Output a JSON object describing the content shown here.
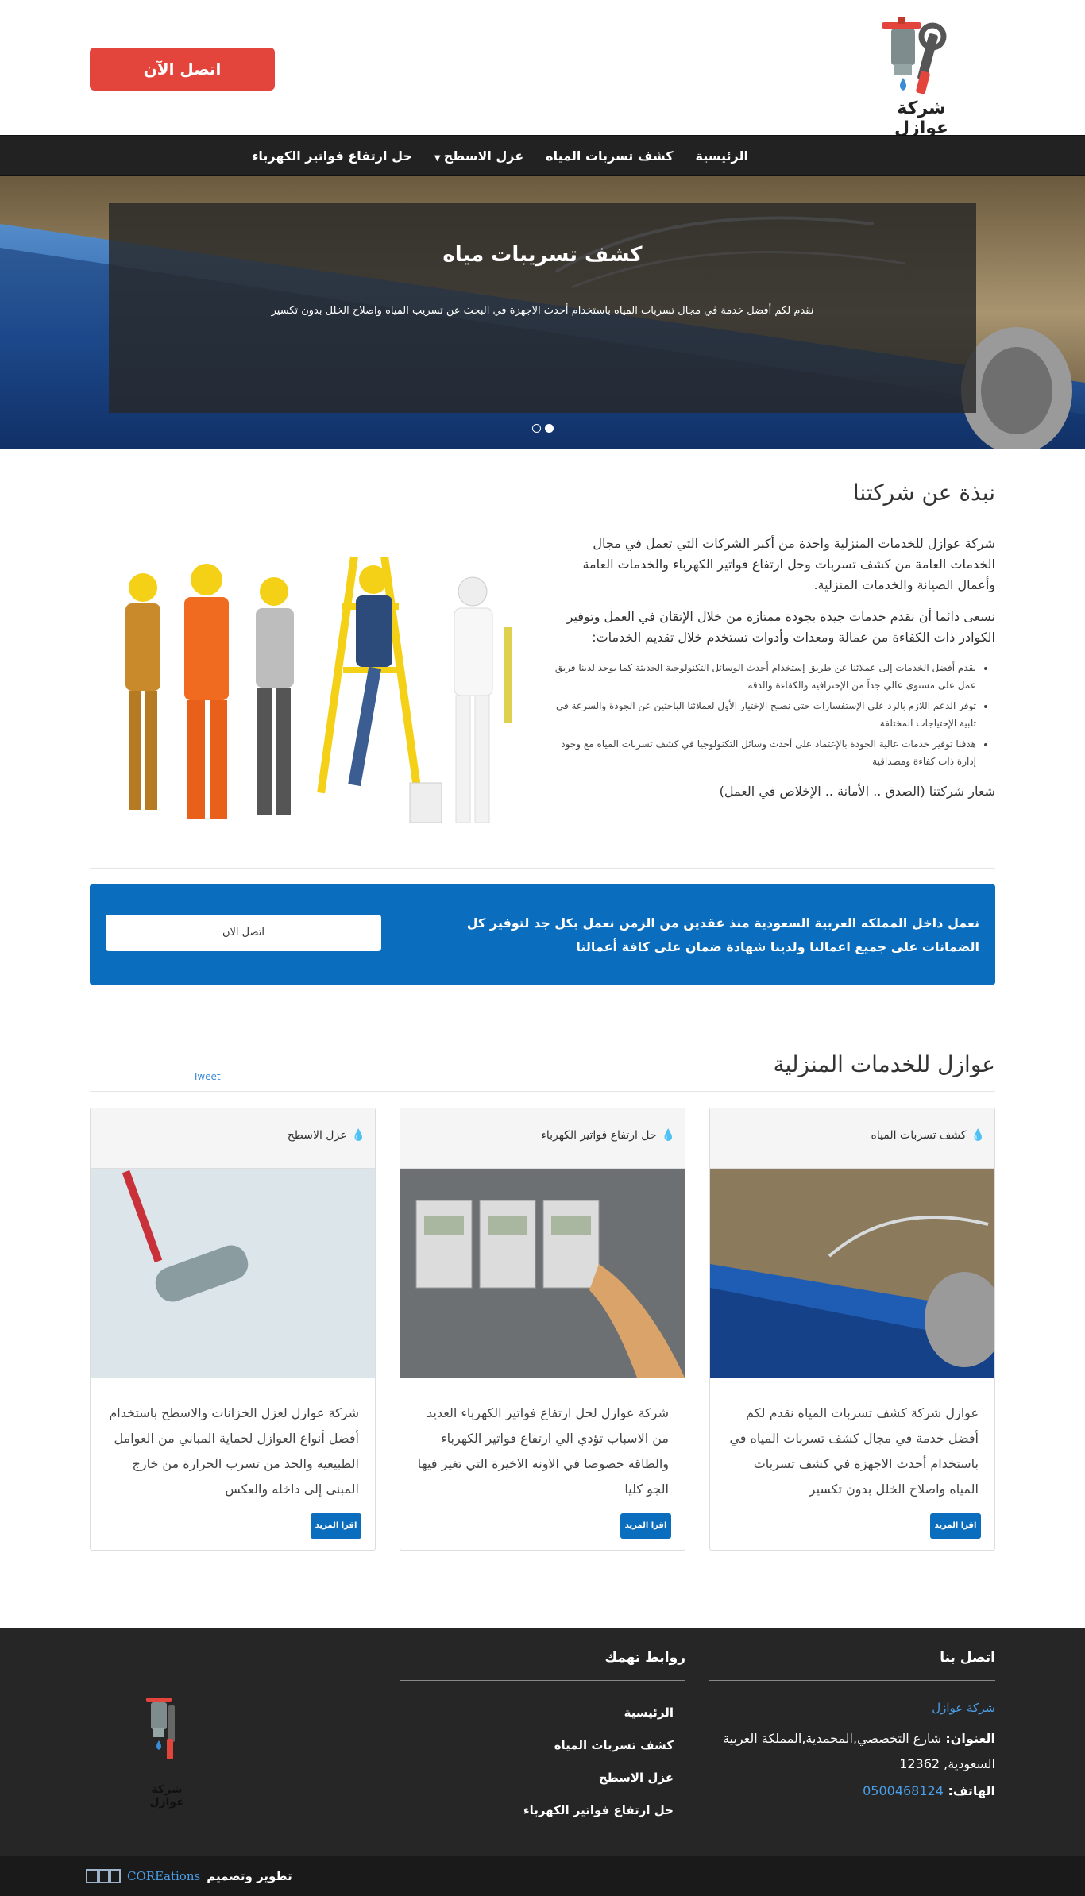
{
  "header": {
    "logo_text": "شركة عوازل",
    "call_button": "اتصل الآن 0500468124"
  },
  "nav": {
    "items": [
      {
        "label": "الرئيسية"
      },
      {
        "label": "كشف تسربات المياه"
      },
      {
        "label": "عزل الاسطح"
      },
      {
        "label": "حل ارتفاع فواتير الكهرباء"
      }
    ]
  },
  "hero": {
    "title": "كشف تسريبات مياه",
    "subtitle": "نقدم لكم أفضل خدمة في مجال تسربات المياه باستخدام أحدث الاجهزة في البحث عن تسريب المياه واصلاح الخلل بدون تكسير",
    "slide_count": 2,
    "active_slide": 2
  },
  "about": {
    "title": "نبذة عن شركتنا",
    "p1": "شركة عوازل للخدمات المنزلية واحدة من أكبر الشركات التي تعمل في مجال الخدمات العامة من كشف تسربات وحل ارتفاع فواتير الكهرباء والخدمات العامة وأعمال الصيانة والخدمات المنزلية.",
    "p2": "نسعى دائما أن نقدم خدمات جيدة بجودة ممتازة من خلال الإتقان في العمل وتوفير الكوادر ذات الكفاءة من عمالة ومعدات وأدوات تستخدم خلال تقديم الخدمات:",
    "bullets": [
      "نقدم أفضل الخدمات إلى عملائنا عن طريق إستخدام أحدث الوسائل التكنولوجية الحديثة كما يوجد لدينا فريق عمل على مستوى عالي جداً من الإحترافية والكفاءة والدقة",
      "توفر الدعم اللازم بالرد على الإستفسارات حتى نصبح الإختيار الأول لعملائنا الباحثين عن الجودة والسرعة في تلبية الإحتياجات المختلفة",
      "هدفنا توفير خدمات عالية الجودة بالإعتماد على أحدث وسائل التكنولوجيا في كشف تسربات المياه مع وجود إدارة ذات كفاءة ومصداقية"
    ],
    "slogan": "شعار شركتنا (الصدق .. الأمانة .. الإخلاص في العمل)"
  },
  "banner": {
    "text": "نعمل داخل المملكه العربية السعودية منذ عقدين من الزمن نعمل بكل جد لتوفير كل الضمانات على جميع اعمالنا ولدينا شهادة ضمان على كافة أعمالنا",
    "button": "اتصل الان"
  },
  "services": {
    "title": "عوازل للخدمات المنزلية",
    "tweet": "Tweet",
    "cards": [
      {
        "title": "كشف تسربات المياه",
        "text": "عوازل شركة كشف تسربات المياه نقدم لكم أفضل خدمة في مجال كشف تسربات المياه في باستخدام أحدث الاجهزة في كشف تسربات المياه واصلاح الخلل بدون تكسير",
        "button": "اقرا المزيد"
      },
      {
        "title": "حل ارتفاع فواتير الكهرباء",
        "text": "شركة عوازل لحل ارتفاع فواتير الكهرباء العديد من الاسباب تؤدي الي ارتفاع فواتير الكهرباء والطاقة خصوصا في الاونه الاخيرة التي تغير فيها الجو كليا",
        "button": "اقرا المزيد"
      },
      {
        "title": "عزل الاسطح",
        "text": "شركة عوازل لعزل الخزانات والاسطح باستخدام أفضل أنواع العوازل لحماية المباني من العوامل الطبيعية والحد من تسرب الحرارة من خارج المبنى إلى داخله والعكس",
        "button": "اقرا المزيد"
      }
    ]
  },
  "footer": {
    "contact_title": "اتصل بنا",
    "company": "شركة عوازل",
    "address_label": "العنوان:",
    "address": "شارع التخصصي,المحمدية,المملكة العربية السعودية, 12362",
    "phone_label": "الهاتف:",
    "phone": "0500468124",
    "links_title": "روابط تهمك",
    "links": [
      "الرئيسية",
      "كشف تسربات المياه",
      "عزل الاسطح",
      "حل ارتفاع فواتير الكهرباء"
    ],
    "logo_text": "شركة عوازل"
  },
  "credit": {
    "text": "تطوير وتصميم",
    "brand": "COREations"
  },
  "colors": {
    "accent_blue": "#0b6dbd",
    "call_red": "#e3453d",
    "nav_dark": "#222222",
    "footer_dark": "#262626"
  }
}
